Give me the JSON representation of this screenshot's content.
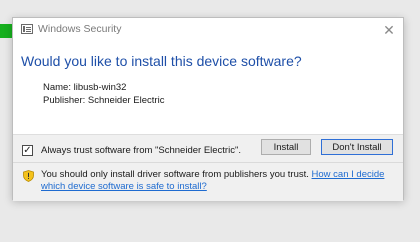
{
  "window": {
    "title": "Windows Security",
    "close_glyph": "✕"
  },
  "dialog": {
    "heading": "Would you like to install this device software?",
    "details": {
      "name_line": "Name: libusb-win32",
      "publisher_line": "Publisher: Schneider Electric"
    }
  },
  "footer": {
    "checkbox": {
      "checked": true,
      "glyph": "✓",
      "label": "Always trust software from \"Schneider Electric\"."
    },
    "buttons": {
      "install": "Install",
      "dont_install": "Don't Install"
    },
    "warning": {
      "icon": "shield-warning-icon",
      "text": "You should only install driver software from publishers you trust.",
      "link": "How can I decide which device software is safe to install?"
    }
  },
  "colors": {
    "heading": "#1e4fa8",
    "link": "#1e6bd0",
    "accent_border": "#2f6fd6",
    "status_green": "#16b01e"
  }
}
